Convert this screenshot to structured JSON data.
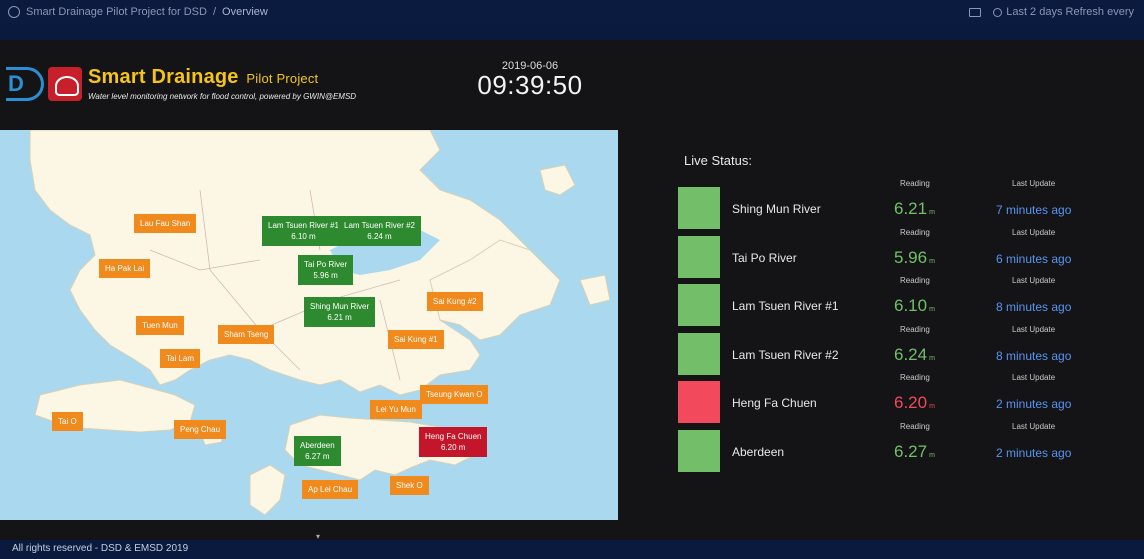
{
  "topbar": {
    "breadcrumb_folder": "Smart Drainage Pilot Project for DSD",
    "breadcrumb_separator": "/",
    "breadcrumb_current": "Overview",
    "time_range": "Last 2 days  Refresh every"
  },
  "header": {
    "title": "Smart Drainage",
    "title_suffix": "Pilot Project",
    "tagline": "Water level monitoring network for flood control, powered by GWIN@EMSD",
    "date": "2019-06-06",
    "time": "09:39:50",
    "logo_dsd": "D"
  },
  "map": {
    "markers": [
      {
        "name": "Lau Fau Shan",
        "value": "",
        "status": "orange"
      },
      {
        "name": "Ha Pak Lai",
        "value": "",
        "status": "orange"
      },
      {
        "name": "Tuen Mun",
        "value": "",
        "status": "orange"
      },
      {
        "name": "Tai Lam",
        "value": "",
        "status": "orange"
      },
      {
        "name": "Sham Tseng",
        "value": "",
        "status": "orange"
      },
      {
        "name": "Tai O",
        "value": "",
        "status": "orange"
      },
      {
        "name": "Peng Chau",
        "value": "",
        "status": "orange"
      },
      {
        "name": "Lam Tsuen River #1",
        "value": "6.10 m",
        "status": "green"
      },
      {
        "name": "Lam Tsuen River #2",
        "value": "6.24 m",
        "status": "green"
      },
      {
        "name": "Tai Po River",
        "value": "5.96 m",
        "status": "green"
      },
      {
        "name": "Shing Mun River",
        "value": "6.21 m",
        "status": "green"
      },
      {
        "name": "Sai Kung #2",
        "value": "",
        "status": "orange"
      },
      {
        "name": "Sai Kung #1",
        "value": "",
        "status": "orange"
      },
      {
        "name": "Tseung Kwan O",
        "value": "",
        "status": "orange"
      },
      {
        "name": "Lei Yu Mun",
        "value": "",
        "status": "orange"
      },
      {
        "name": "Heng Fa Chuen",
        "value": "6.20 m",
        "status": "red"
      },
      {
        "name": "Aberdeen",
        "value": "6.27 m",
        "status": "green"
      },
      {
        "name": "Ap Lei Chau",
        "value": "",
        "status": "orange"
      },
      {
        "name": "Shek O",
        "value": "",
        "status": "orange"
      }
    ]
  },
  "live_status": {
    "title": "Live Status:",
    "reading_label": "Reading",
    "update_label": "Last Update",
    "unit": "m",
    "rows": [
      {
        "name": "Shing Mun River",
        "reading": "6.21",
        "updated": "7 minutes ago",
        "status": "ok"
      },
      {
        "name": "Tai Po River",
        "reading": "5.96",
        "updated": "6 minutes ago",
        "status": "ok"
      },
      {
        "name": "Lam Tsuen River #1",
        "reading": "6.10",
        "updated": "8 minutes ago",
        "status": "ok"
      },
      {
        "name": "Lam Tsuen River #2",
        "reading": "6.24",
        "updated": "8 minutes ago",
        "status": "ok"
      },
      {
        "name": "Heng Fa Chuen",
        "reading": "6.20",
        "updated": "2 minutes ago",
        "status": "alert"
      },
      {
        "name": "Aberdeen",
        "reading": "6.27",
        "updated": "2 minutes ago",
        "status": "ok"
      }
    ]
  },
  "footer": {
    "text": "All rights reserved - DSD & EMSD 2019",
    "caret": "▾"
  },
  "colors": {
    "ok": "#73bf69",
    "alert": "#f2495c",
    "link": "#5794f2",
    "title": "#f5c518",
    "marker_orange": "#f08a1c",
    "marker_green": "#2e8a2e",
    "marker_red": "#c4162a"
  }
}
